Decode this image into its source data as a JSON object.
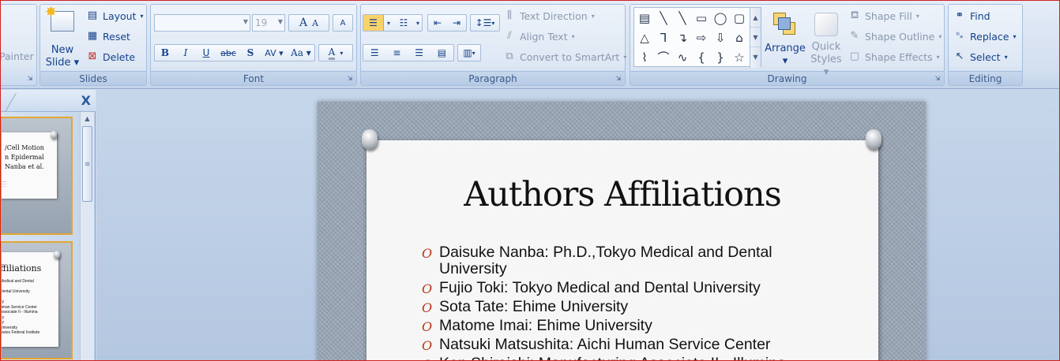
{
  "ribbon": {
    "clipboard": {
      "format_painter_partial": "Painter"
    },
    "slides": {
      "group_label": "Slides",
      "new_slide_line1": "New",
      "new_slide_line2": "Slide",
      "layout": "Layout",
      "reset": "Reset",
      "delete": "Delete"
    },
    "font": {
      "group_label": "Font",
      "font_name_value": "",
      "font_size_value": "19",
      "grow_font": "A",
      "shrink_font": "A",
      "clear_formatting": "A",
      "bold": "B",
      "italic": "I",
      "underline": "U",
      "strikethrough": "abc",
      "shadow": "S",
      "char_spacing": "AV",
      "change_case": "Aa",
      "font_color": "A"
    },
    "paragraph": {
      "group_label": "Paragraph",
      "text_direction": "Text Direction",
      "align_text": "Align Text",
      "convert_smartart": "Convert to SmartArt"
    },
    "drawing": {
      "group_label": "Drawing",
      "arrange": "Arrange",
      "quick_styles_line1": "Quick",
      "quick_styles_line2": "Styles",
      "shape_fill": "Shape Fill",
      "shape_outline": "Shape Outline",
      "shape_effects": "Shape Effects",
      "shapes": [
        "▤",
        "╲",
        "╲",
        "▭",
        "◯",
        "▢",
        "△",
        "⅂",
        "↴",
        "⇨",
        "⇩",
        "⌂",
        "⌇",
        "⌒",
        "∿",
        "{",
        "}",
        "☆"
      ]
    },
    "editing": {
      "group_label": "Editing",
      "find": "Find",
      "replace": "Replace",
      "select": "Select"
    }
  },
  "slides_pane": {
    "close": "X",
    "thumb1": {
      "lines": [
        "/Cell Motion",
        "n Epidermal",
        "Nanba et al."
      ]
    },
    "thumb2": {
      "title": "ffiliations",
      "lines": [
        "Medical and Dental",
        "Dental University",
        "ity",
        "uman Service Center",
        "Associate II - Illumina",
        "ity",
        "ity",
        "University",
        "Swiss Federal Institute"
      ]
    }
  },
  "slide": {
    "title": "Authors Affiliations",
    "bullet_glyph": "O",
    "bullets": [
      "Daisuke Nanba: Ph.D.,Tokyo Medical and Dental University",
      "Fujio Toki: Tokyo Medical and Dental University",
      "Sota Tate: Ehime University",
      "Matome Imai: Ehime University",
      "Natsuki Matsushita: Aichi Human Service Center",
      "Ken Shiraishi: Manufacturing Associate II - Illumina"
    ]
  },
  "colors": {
    "accent": "#15428b",
    "bullet": "#b4371e",
    "selection": "#e5a630"
  }
}
